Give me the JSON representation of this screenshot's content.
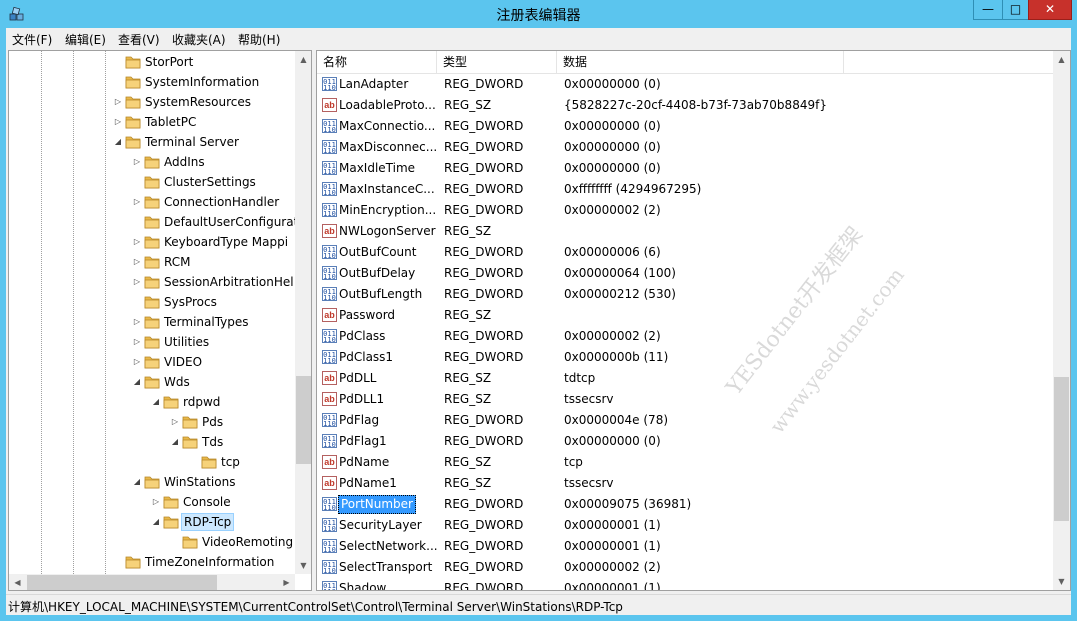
{
  "window": {
    "title": "注册表编辑器",
    "minimize": "—",
    "maximize": "□",
    "close": "✕"
  },
  "menu": [
    "文件(F)",
    "编辑(E)",
    "查看(V)",
    "收藏夹(A)",
    "帮助(H)"
  ],
  "tree": {
    "items": [
      {
        "label": "StorPort",
        "depth": 0,
        "arrow": ""
      },
      {
        "label": "SystemInformation",
        "depth": 0,
        "arrow": ""
      },
      {
        "label": "SystemResources",
        "depth": 0,
        "arrow": "▷"
      },
      {
        "label": "TabletPC",
        "depth": 0,
        "arrow": "▷"
      },
      {
        "label": "Terminal Server",
        "depth": 0,
        "arrow": "◢"
      },
      {
        "label": "AddIns",
        "depth": 1,
        "arrow": "▷"
      },
      {
        "label": "ClusterSettings",
        "depth": 1,
        "arrow": ""
      },
      {
        "label": "ConnectionHandler",
        "depth": 1,
        "arrow": "▷"
      },
      {
        "label": "DefaultUserConfigurat",
        "depth": 1,
        "arrow": ""
      },
      {
        "label": "KeyboardType Mappi",
        "depth": 1,
        "arrow": "▷"
      },
      {
        "label": "RCM",
        "depth": 1,
        "arrow": "▷"
      },
      {
        "label": "SessionArbitrationHel",
        "depth": 1,
        "arrow": "▷"
      },
      {
        "label": "SysProcs",
        "depth": 1,
        "arrow": ""
      },
      {
        "label": "TerminalTypes",
        "depth": 1,
        "arrow": "▷"
      },
      {
        "label": "Utilities",
        "depth": 1,
        "arrow": "▷"
      },
      {
        "label": "VIDEO",
        "depth": 1,
        "arrow": "▷"
      },
      {
        "label": "Wds",
        "depth": 1,
        "arrow": "◢"
      },
      {
        "label": "rdpwd",
        "depth": 2,
        "arrow": "◢"
      },
      {
        "label": "Pds",
        "depth": 3,
        "arrow": "▷"
      },
      {
        "label": "Tds",
        "depth": 3,
        "arrow": "◢"
      },
      {
        "label": "tcp",
        "depth": 4,
        "arrow": ""
      },
      {
        "label": "WinStations",
        "depth": 1,
        "arrow": "◢"
      },
      {
        "label": "Console",
        "depth": 2,
        "arrow": "▷"
      },
      {
        "label": "RDP-Tcp",
        "depth": 2,
        "arrow": "◢",
        "selected": true
      },
      {
        "label": "VideoRemoting",
        "depth": 3,
        "arrow": ""
      },
      {
        "label": "TimeZoneInformation",
        "depth": 0,
        "arrow": ""
      }
    ]
  },
  "list": {
    "columns": [
      "名称",
      "类型",
      "数据"
    ],
    "rows": [
      {
        "name": "LanAdapter",
        "type": "REG_DWORD",
        "data": "0x00000000 (0)",
        "icon": "bin"
      },
      {
        "name": "LoadableProto...",
        "type": "REG_SZ",
        "data": "{5828227c-20cf-4408-b73f-73ab70b8849f}",
        "icon": "sz"
      },
      {
        "name": "MaxConnectio...",
        "type": "REG_DWORD",
        "data": "0x00000000 (0)",
        "icon": "bin"
      },
      {
        "name": "MaxDisconnec...",
        "type": "REG_DWORD",
        "data": "0x00000000 (0)",
        "icon": "bin"
      },
      {
        "name": "MaxIdleTime",
        "type": "REG_DWORD",
        "data": "0x00000000 (0)",
        "icon": "bin"
      },
      {
        "name": "MaxInstanceC...",
        "type": "REG_DWORD",
        "data": "0xffffffff (4294967295)",
        "icon": "bin"
      },
      {
        "name": "MinEncryption...",
        "type": "REG_DWORD",
        "data": "0x00000002 (2)",
        "icon": "bin"
      },
      {
        "name": "NWLogonServer",
        "type": "REG_SZ",
        "data": "",
        "icon": "sz"
      },
      {
        "name": "OutBufCount",
        "type": "REG_DWORD",
        "data": "0x00000006 (6)",
        "icon": "bin"
      },
      {
        "name": "OutBufDelay",
        "type": "REG_DWORD",
        "data": "0x00000064 (100)",
        "icon": "bin"
      },
      {
        "name": "OutBufLength",
        "type": "REG_DWORD",
        "data": "0x00000212 (530)",
        "icon": "bin"
      },
      {
        "name": "Password",
        "type": "REG_SZ",
        "data": "",
        "icon": "sz"
      },
      {
        "name": "PdClass",
        "type": "REG_DWORD",
        "data": "0x00000002 (2)",
        "icon": "bin"
      },
      {
        "name": "PdClass1",
        "type": "REG_DWORD",
        "data": "0x0000000b (11)",
        "icon": "bin"
      },
      {
        "name": "PdDLL",
        "type": "REG_SZ",
        "data": "tdtcp",
        "icon": "sz"
      },
      {
        "name": "PdDLL1",
        "type": "REG_SZ",
        "data": "tssecsrv",
        "icon": "sz"
      },
      {
        "name": "PdFlag",
        "type": "REG_DWORD",
        "data": "0x0000004e (78)",
        "icon": "bin"
      },
      {
        "name": "PdFlag1",
        "type": "REG_DWORD",
        "data": "0x00000000 (0)",
        "icon": "bin"
      },
      {
        "name": "PdName",
        "type": "REG_SZ",
        "data": "tcp",
        "icon": "sz"
      },
      {
        "name": "PdName1",
        "type": "REG_SZ",
        "data": "tssecsrv",
        "icon": "sz"
      },
      {
        "name": "PortNumber",
        "type": "REG_DWORD",
        "data": "0x00009075 (36981)",
        "icon": "bin",
        "selected": true
      },
      {
        "name": "SecurityLayer",
        "type": "REG_DWORD",
        "data": "0x00000001 (1)",
        "icon": "bin"
      },
      {
        "name": "SelectNetwork...",
        "type": "REG_DWORD",
        "data": "0x00000001 (1)",
        "icon": "bin"
      },
      {
        "name": "SelectTransport",
        "type": "REG_DWORD",
        "data": "0x00000002 (2)",
        "icon": "bin"
      },
      {
        "name": "Shadow",
        "type": "REG_DWORD",
        "data": "0x00000001 (1)",
        "icon": "bin"
      }
    ]
  },
  "icons": {
    "bin_glyph": "011\n110",
    "sz_glyph": "ab"
  },
  "statusbar": {
    "path": "计算机\\HKEY_LOCAL_MACHINE\\SYSTEM\\CurrentControlSet\\Control\\Terminal Server\\WinStations\\RDP-Tcp"
  },
  "watermark": {
    "line1": "YESdotnet开发框架",
    "line2": "www.yesdotnet.com"
  },
  "scroll": {
    "tree_vertical_thumb": 0.78,
    "list_vertical_thumb": 0.65
  }
}
